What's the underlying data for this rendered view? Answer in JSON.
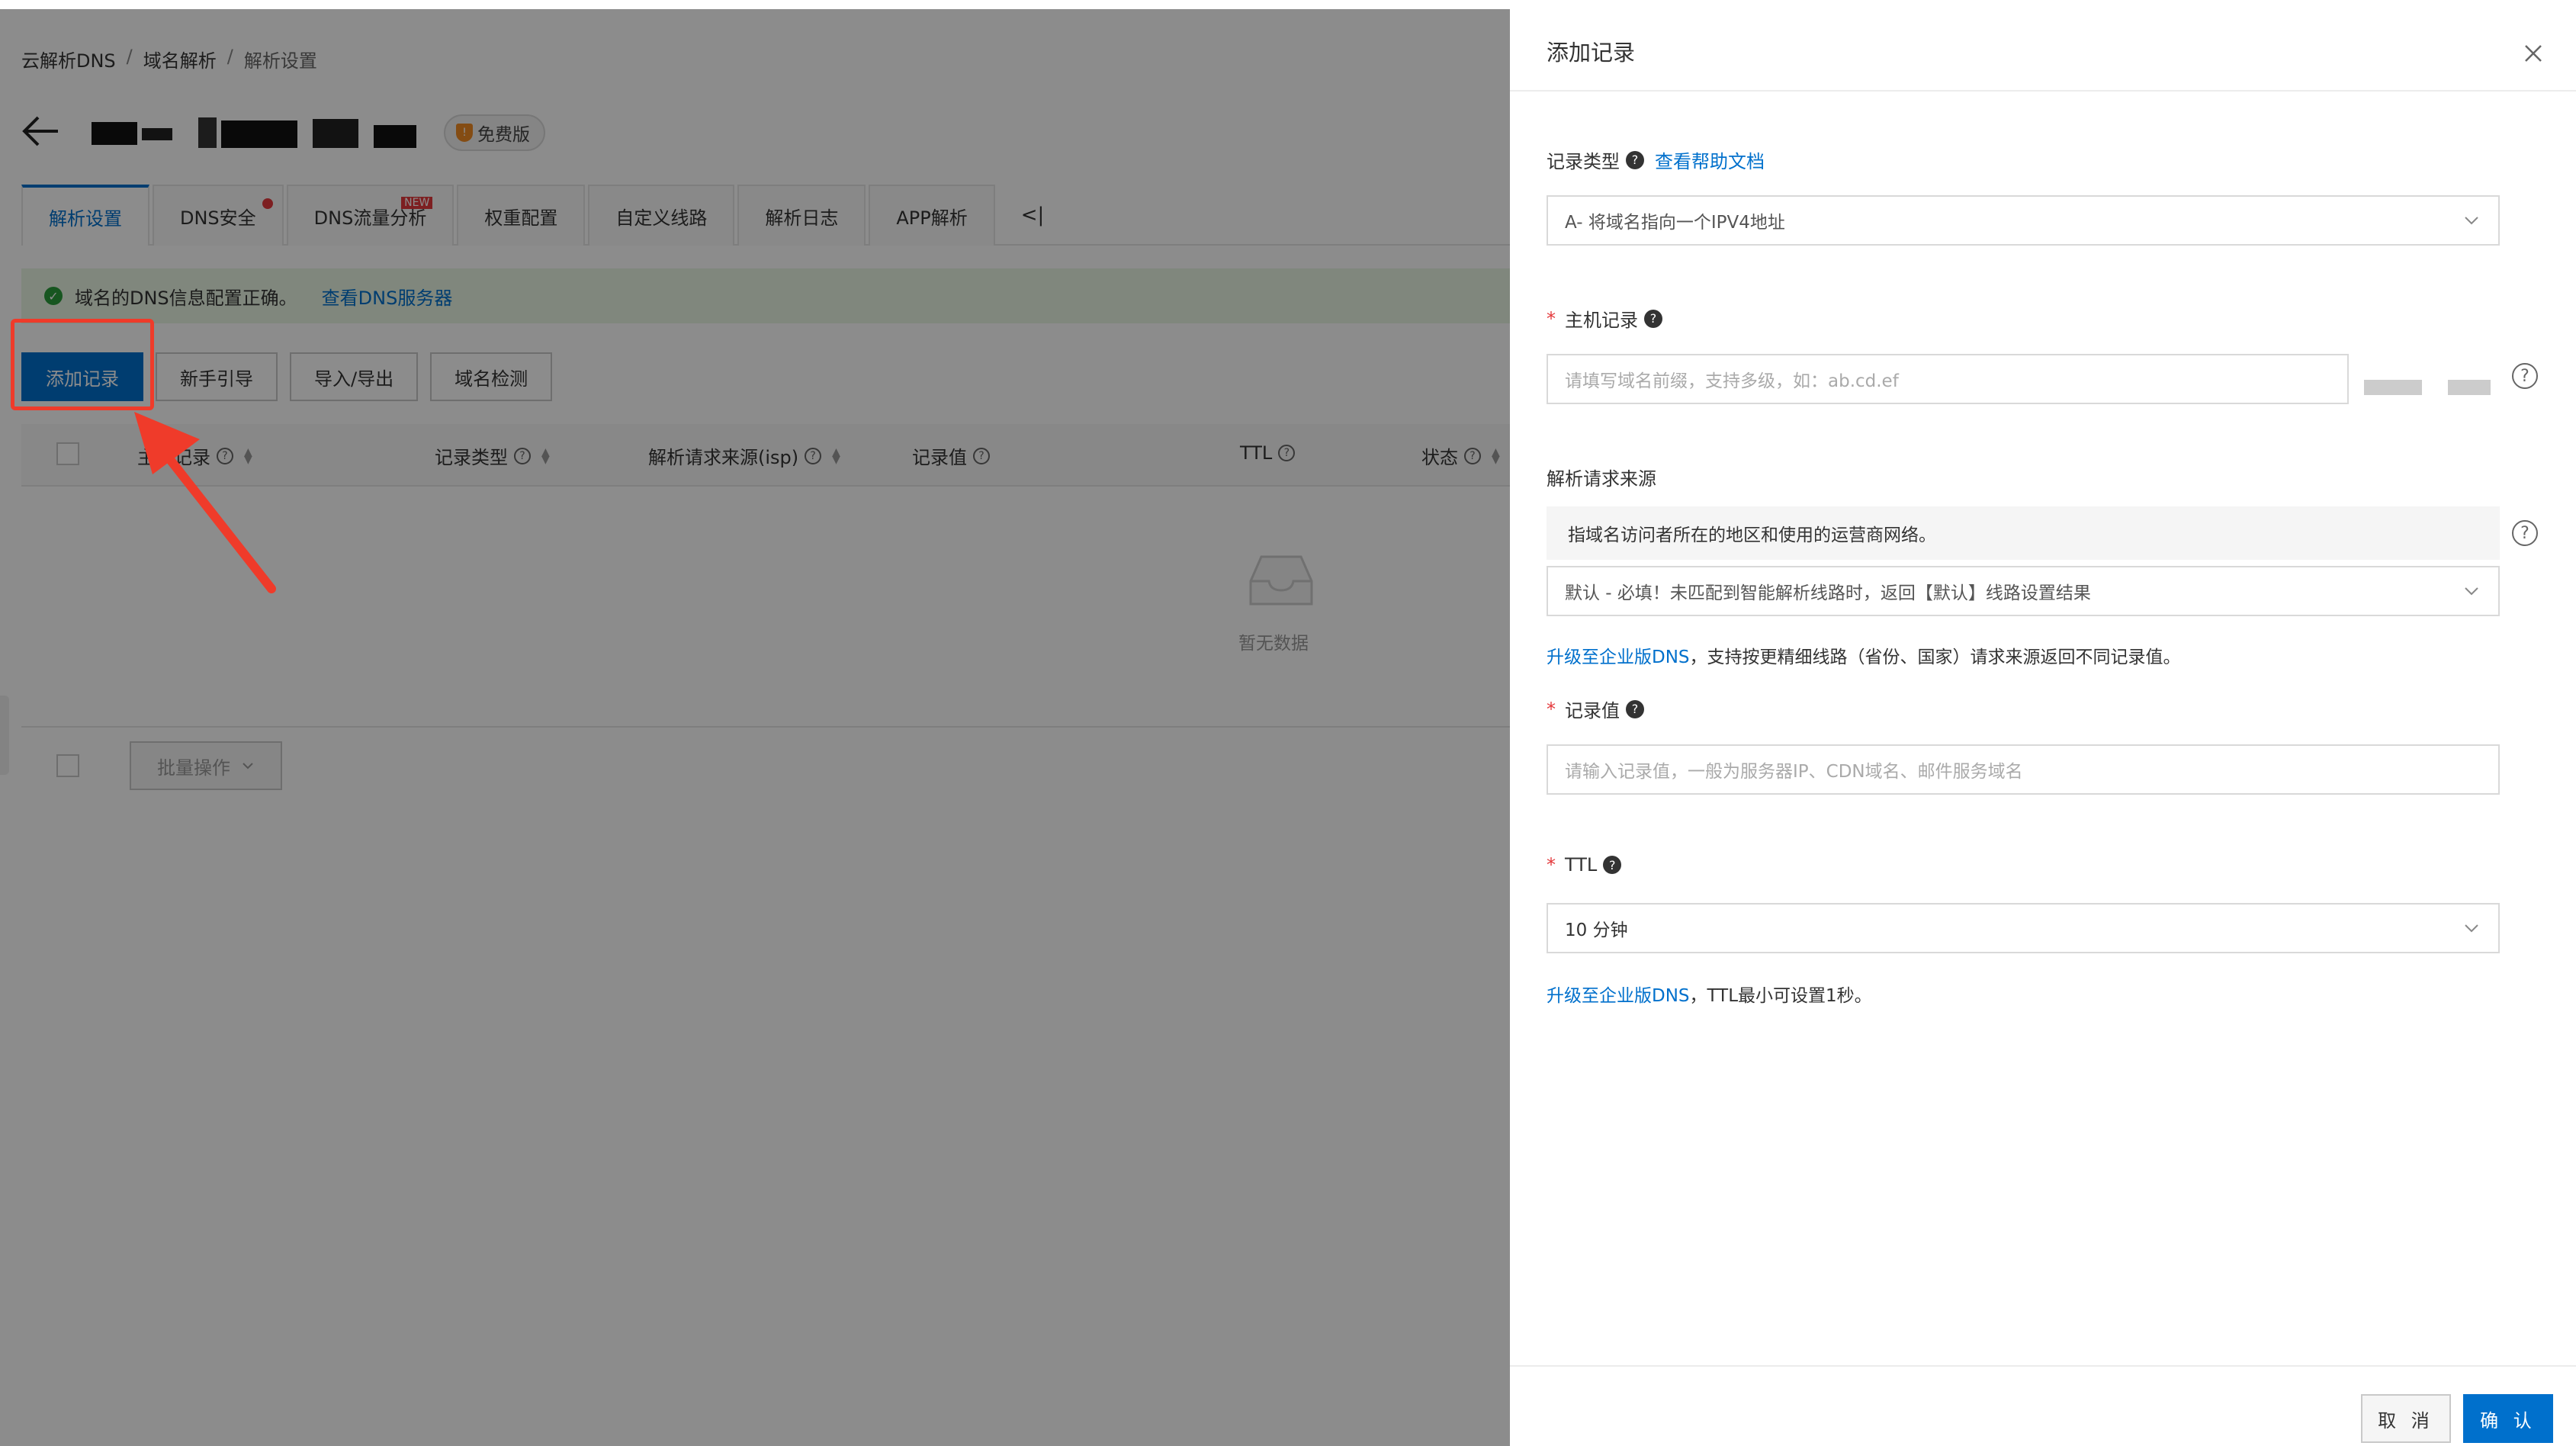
{
  "breadcrumb": [
    "云解析DNS",
    "域名解析",
    "解析设置"
  ],
  "breadcrumb_sep": "/",
  "domain_badge": "免费版",
  "tabs": [
    {
      "label": "解析设置",
      "active": true
    },
    {
      "label": "DNS安全",
      "dot": true
    },
    {
      "label": "DNS流量分析",
      "new": "NEW"
    },
    {
      "label": "权重配置"
    },
    {
      "label": "自定义线路"
    },
    {
      "label": "解析日志"
    },
    {
      "label": "APP解析"
    }
  ],
  "collapse_tab": "<|",
  "notice": {
    "text": "域名的DNS信息配置正确。",
    "link": "查看DNS服务器"
  },
  "toolbar": {
    "add": "添加记录",
    "guide": "新手引导",
    "import_export": "导入/导出",
    "check": "域名检测"
  },
  "table": {
    "columns": [
      "主机记录",
      "记录类型",
      "解析请求来源(isp)",
      "记录值",
      "TTL",
      "状态"
    ],
    "empty_text": "暂无数据",
    "batch": "批量操作"
  },
  "drawer": {
    "title": "添加记录",
    "record_type_label": "记录类型",
    "help_link": "查看帮助文档",
    "record_type_value": "A- 将域名指向一个IPV4地址",
    "host_label": "主机记录",
    "host_placeholder": "请填写域名前缀，支持多级，如：ab.cd.ef",
    "source_label": "解析请求来源",
    "source_desc": "指域名访问者所在的地区和使用的运营商网络。",
    "source_value": "默认 - 必填！未匹配到智能解析线路时，返回【默认】线路设置结果",
    "source_tip_link": "升级至企业版DNS",
    "source_tip": "，支持按更精细线路（省份、国家）请求来源返回不同记录值。",
    "value_label": "记录值",
    "value_placeholder": "请输入记录值，一般为服务器IP、CDN域名、邮件服务域名",
    "ttl_label": "TTL",
    "ttl_value": "10 分钟",
    "ttl_tip_link": "升级至企业版DNS",
    "ttl_tip": "，TTL最小可设置1秒。",
    "cancel": "取 消",
    "confirm": "确 认"
  },
  "colors": {
    "primary": "#0070cc",
    "required": "#e4393c",
    "highlight": "#ef3b2a",
    "success": "#2a9d3b"
  }
}
